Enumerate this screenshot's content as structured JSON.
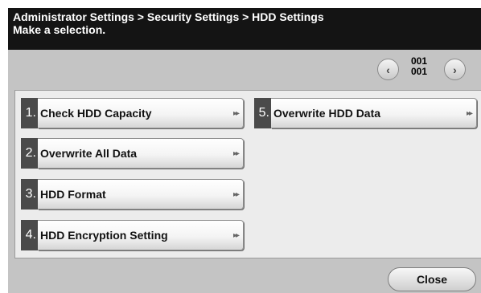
{
  "header": {
    "breadcrumb": "Administrator Settings > Security Settings > HDD Settings",
    "instruction": "Make a selection."
  },
  "pagination": {
    "current": "001",
    "total": "001",
    "prev_icon": "chevron-left-icon",
    "next_icon": "chevron-right-icon"
  },
  "menu": {
    "items": [
      {
        "number": "1.",
        "label": "Check HDD Capacity"
      },
      {
        "number": "2.",
        "label": "Overwrite All Data"
      },
      {
        "number": "3.",
        "label": "HDD Format"
      },
      {
        "number": "4.",
        "label": "HDD Encryption Setting"
      },
      {
        "number": "5.",
        "label": "Overwrite HDD Data"
      }
    ],
    "arrow_icon": "double-chevron-right-icon"
  },
  "footer": {
    "close_label": "Close"
  },
  "colors": {
    "header_bg": "#141414",
    "frame_bg": "#c4c4c4",
    "panel_bg": "#ececec",
    "number_bg": "#4a4a4a"
  }
}
